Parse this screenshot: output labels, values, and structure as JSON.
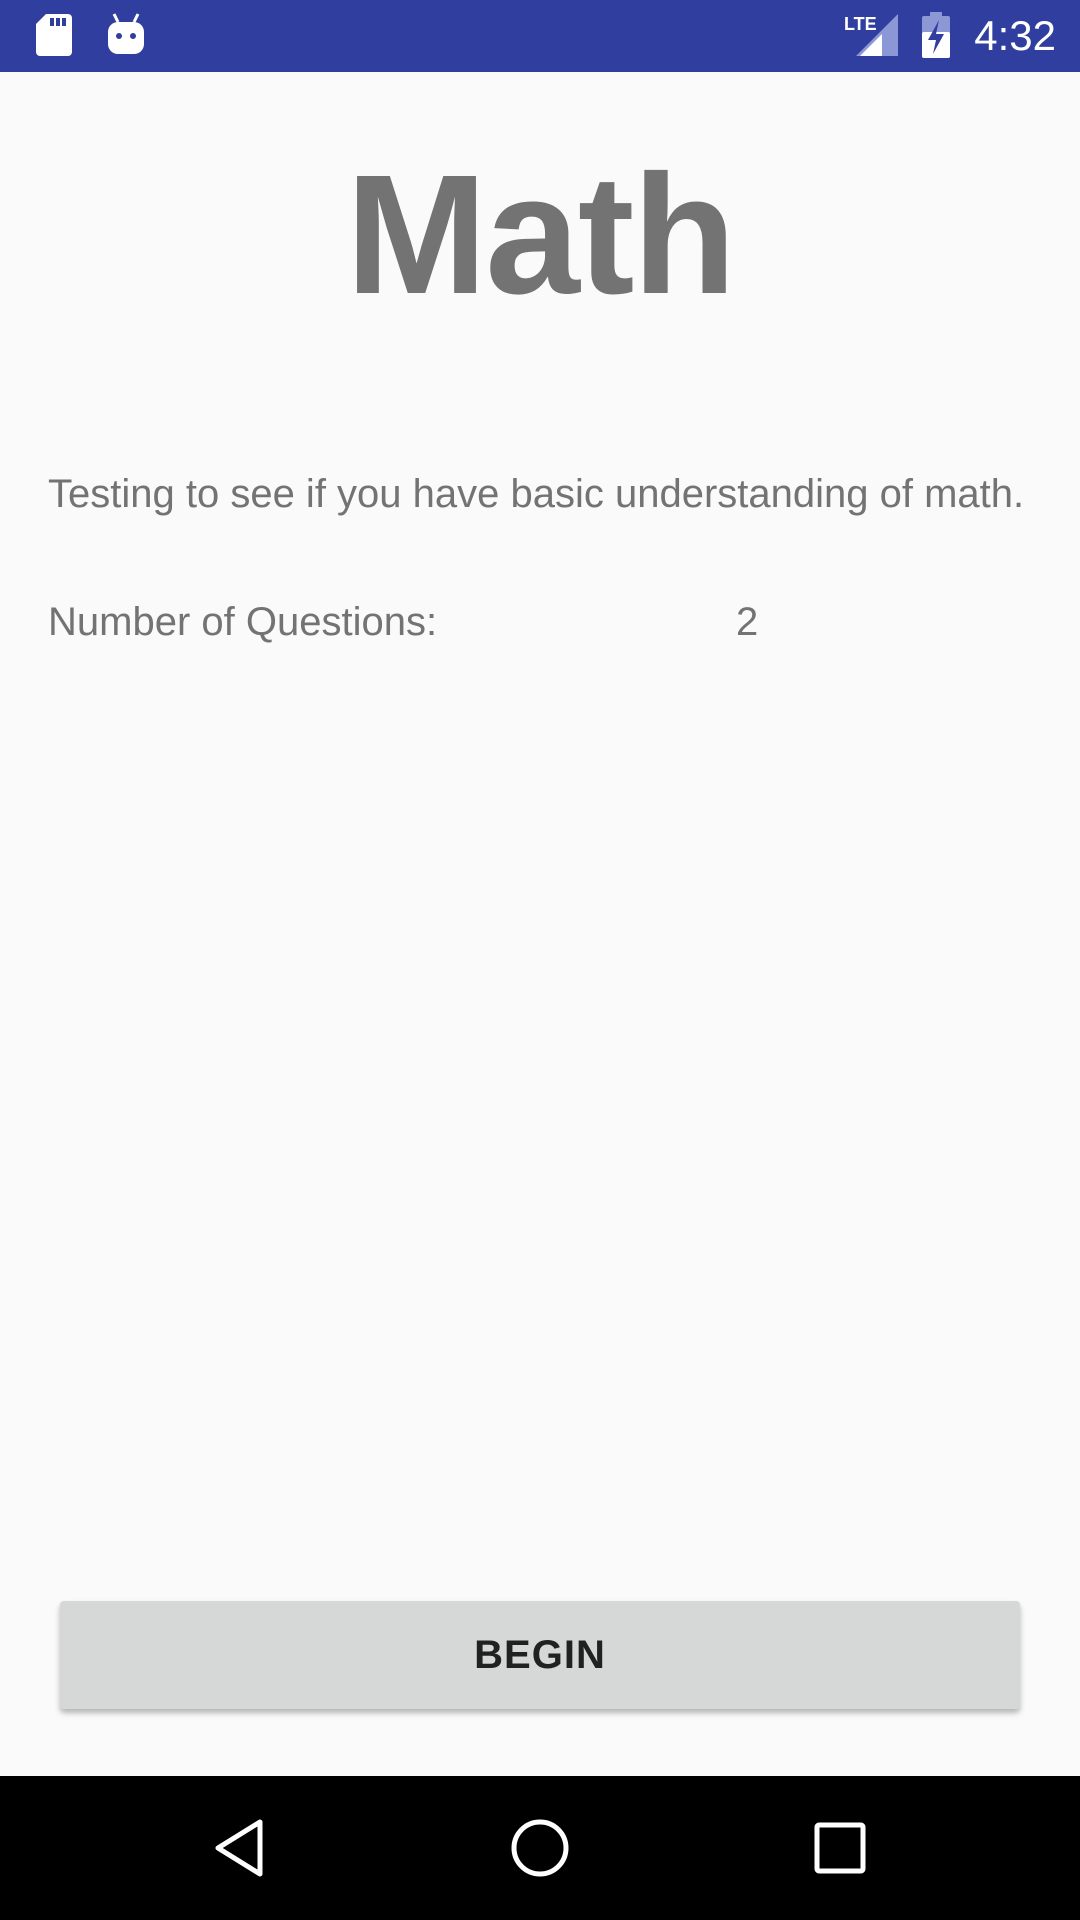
{
  "status_bar": {
    "time": "4:32",
    "network": "LTE",
    "icons": [
      "sd-card-icon",
      "android-debug-icon",
      "lte-signal-icon",
      "battery-charging-icon"
    ],
    "background_color": "#303f9f"
  },
  "main": {
    "title": "Math",
    "description": "Testing to see if you have basic understanding of math.",
    "questions_label": "Number of Questions:",
    "questions_value": "2"
  },
  "actions": {
    "begin_label": "BEGIN"
  },
  "nav_bar": {
    "icons": [
      "back-icon",
      "home-icon",
      "recents-icon"
    ]
  }
}
